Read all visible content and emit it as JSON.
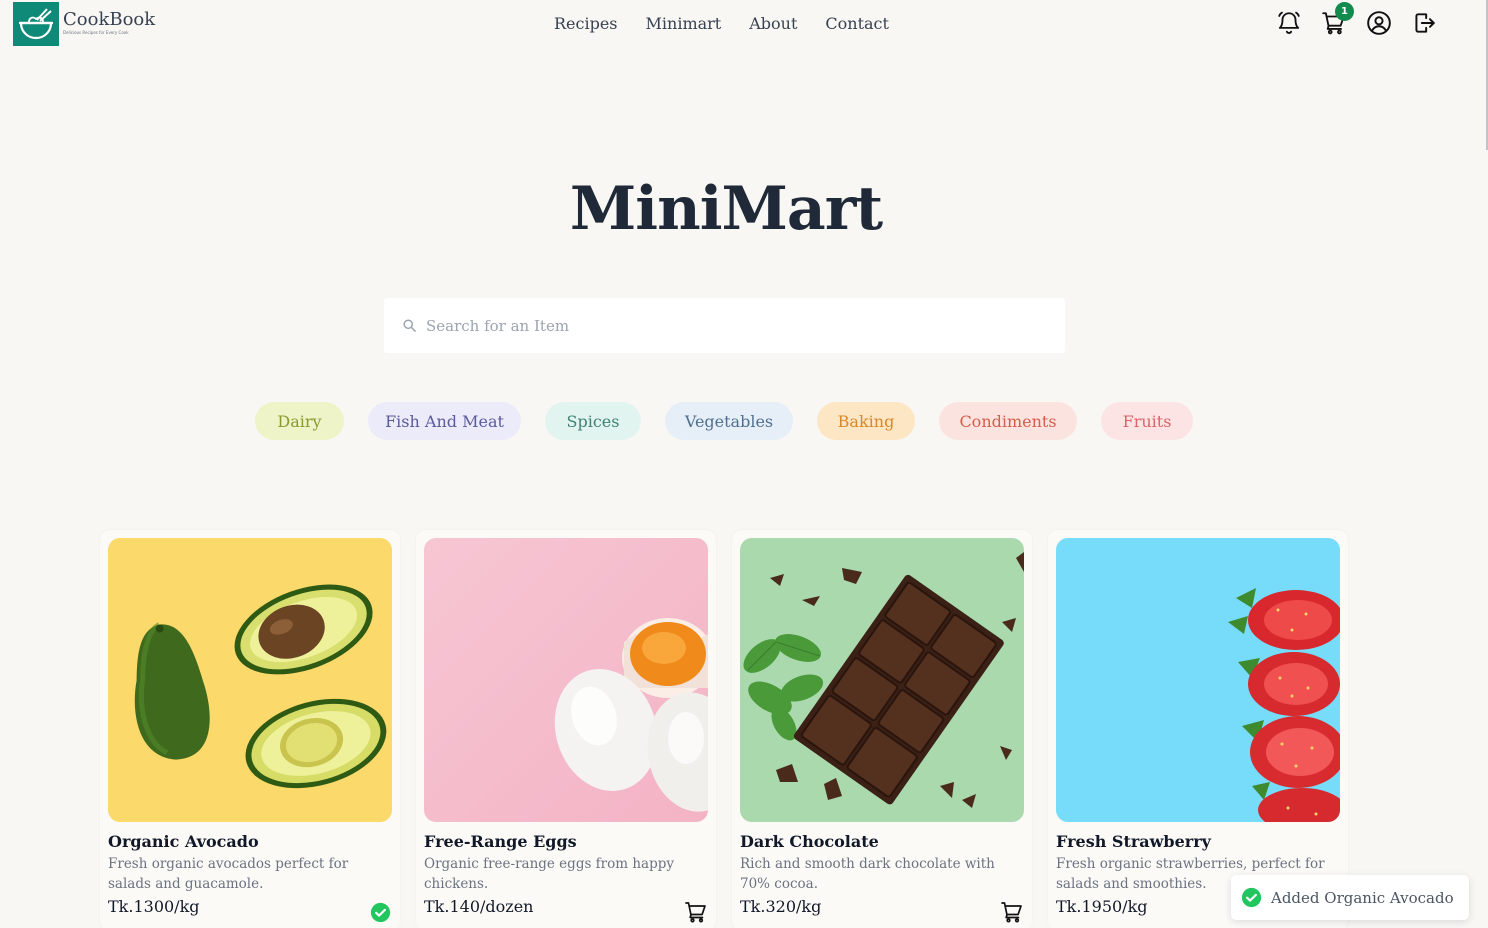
{
  "header": {
    "logo_title": "CookBook",
    "logo_tagline": "Delicious Recipes for Every Cook",
    "nav": [
      "Recipes",
      "Minimart",
      "About",
      "Contact"
    ],
    "cart_count": "1",
    "icons": [
      "bell-icon",
      "cart-icon",
      "user-circle-icon",
      "logout-icon"
    ]
  },
  "main": {
    "title": "MiniMart",
    "search_placeholder": "Search for an Item"
  },
  "categories": [
    {
      "label": "Dairy",
      "bg": "#eef4c8",
      "color": "#8a9a2e"
    },
    {
      "label": "Fish And Meat",
      "bg": "#ecebfa",
      "color": "#5b5a9a"
    },
    {
      "label": "Spices",
      "bg": "#e2f4ef",
      "color": "#3f8273"
    },
    {
      "label": "Vegetables",
      "bg": "#e6eff7",
      "color": "#4f6f8f"
    },
    {
      "label": "Baking",
      "bg": "#fde6c4",
      "color": "#d8872b"
    },
    {
      "label": "Condiments",
      "bg": "#fbe3df",
      "color": "#d75d4b"
    },
    {
      "label": "Fruits",
      "bg": "#fce4e4",
      "color": "#d9656a"
    }
  ],
  "products": [
    {
      "name": "Organic Avocado",
      "desc": "Fresh organic avocados perfect for salads and guacamole.",
      "price": "Tk.1300/kg",
      "in_cart": true,
      "image": "avocado"
    },
    {
      "name": "Free-Range Eggs",
      "desc": "Organic free-range eggs from happy chickens.",
      "price": "Tk.140/dozen",
      "in_cart": false,
      "image": "eggs"
    },
    {
      "name": "Dark Chocolate",
      "desc": "Rich and smooth dark chocolate with 70% cocoa.",
      "price": "Tk.320/kg",
      "in_cart": false,
      "image": "chocolate"
    },
    {
      "name": "Fresh Strawberry",
      "desc": "Fresh organic strawberries, perfect for salads and smoothies.",
      "price": "Tk.1950/kg",
      "in_cart": false,
      "image": "strawberry"
    }
  ],
  "toast": {
    "text": "Added Organic Avocado"
  },
  "colors": {
    "brand": "#0f8a78",
    "success": "#22c55e",
    "badge": "#138a4e",
    "background": "#f8f7f4"
  }
}
